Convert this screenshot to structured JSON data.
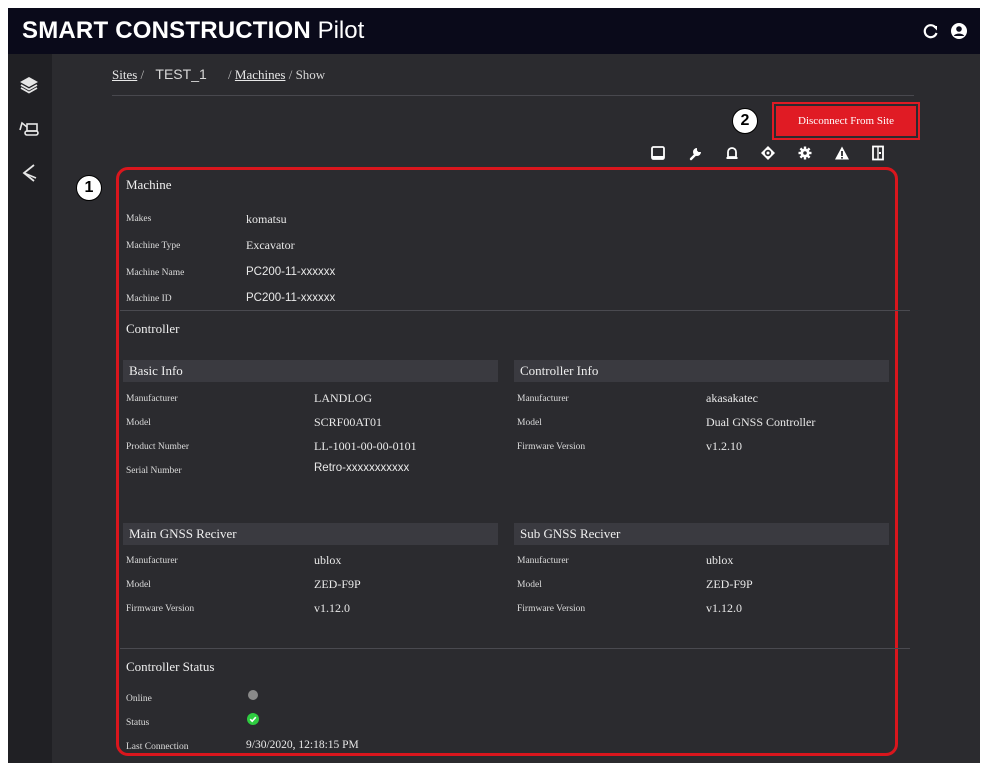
{
  "app": {
    "brand_bold": "SMART CONSTRUCTION",
    "brand_light": "Pilot"
  },
  "topbar": {
    "icons": [
      "refresh-icon",
      "user-account-icon"
    ]
  },
  "sidebar": {
    "icons": [
      "layers-icon",
      "machines-icon",
      "excavator-arm-icon"
    ]
  },
  "breadcrumb": {
    "sites": "Sites",
    "sep1": "/",
    "site_name": "TEST_1",
    "sep2": "/",
    "machines": "Machines",
    "sep3": "/",
    "current": "Show"
  },
  "annotations": {
    "badge1": "1",
    "badge2": "2"
  },
  "actions": {
    "disconnect_label": "Disconnect From Site"
  },
  "toolbar": {
    "icons": [
      "tablet-icon",
      "wrench-icon",
      "bell-icon",
      "target-icon",
      "gear-icon",
      "warning-icon",
      "document-icon"
    ]
  },
  "machine": {
    "title": "Machine",
    "rows": [
      {
        "label": "Makes",
        "value": "komatsu"
      },
      {
        "label": "Machine Type",
        "value": "Excavator"
      },
      {
        "label": "Machine Name",
        "value": "PC200-11-xxxxxx"
      },
      {
        "label": "Machine ID",
        "value": "PC200-11-xxxxxx"
      }
    ]
  },
  "controller": {
    "title": "Controller",
    "basic_info": {
      "title": "Basic Info",
      "rows": [
        {
          "label": "Manufacturer",
          "value": "LANDLOG"
        },
        {
          "label": "Model",
          "value": "SCRF00AT01"
        },
        {
          "label": "Product Number",
          "value": "LL-1001-00-00-0101"
        },
        {
          "label": "Serial Number",
          "value": "Retro-xxxxxxxxxxx"
        }
      ]
    },
    "controller_info": {
      "title": "Controller Info",
      "rows": [
        {
          "label": "Manufacturer",
          "value": "akasakatec"
        },
        {
          "label": "Model",
          "value": "Dual GNSS Controller"
        },
        {
          "label": "Firmware Version",
          "value": "v1.2.10"
        }
      ]
    },
    "main_gnss": {
      "title": "Main GNSS Reciver",
      "rows": [
        {
          "label": "Manufacturer",
          "value": "ublox"
        },
        {
          "label": "Model",
          "value": "ZED-F9P"
        },
        {
          "label": "Firmware Version",
          "value": "v1.12.0"
        }
      ]
    },
    "sub_gnss": {
      "title": "Sub GNSS Reciver",
      "rows": [
        {
          "label": "Manufacturer",
          "value": "ublox"
        },
        {
          "label": "Model",
          "value": "ZED-F9P"
        },
        {
          "label": "Firmware Version",
          "value": "v1.12.0"
        }
      ]
    }
  },
  "controller_status": {
    "title": "Controller Status",
    "online_label": "Online",
    "status_label": "Status",
    "last_connection_label": "Last Connection",
    "last_connection_value": "9/30/2020, 12:18:15 PM",
    "online_color": "#8a8a8a",
    "status_color": "#2ecc40"
  },
  "colors": {
    "accent_red": "#e01b24",
    "background": "#2b2b2f",
    "topbar": "#0a0a1a"
  }
}
